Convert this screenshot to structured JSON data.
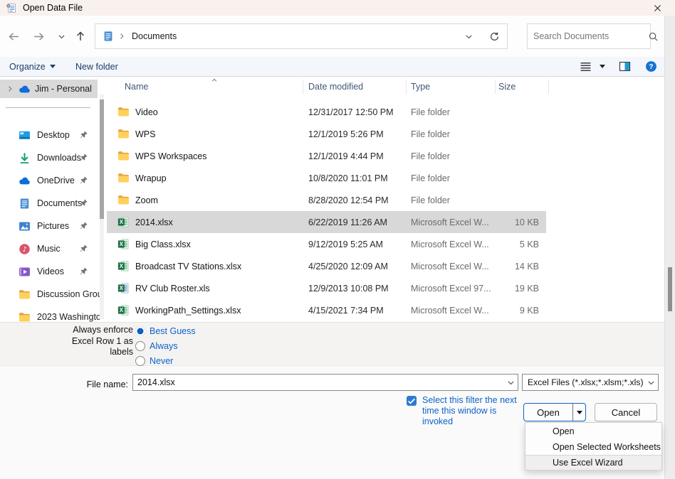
{
  "window": {
    "title": "Open Data File"
  },
  "nav": {
    "breadcrumb": "Documents",
    "search_placeholder": "Search Documents"
  },
  "toolbar": {
    "organize": "Organize",
    "new_folder": "New folder"
  },
  "sidebar": {
    "root_label": "Jim - Personal",
    "items": [
      {
        "label": "Desktop",
        "icon": "desktop",
        "pinned": true
      },
      {
        "label": "Downloads",
        "icon": "downloads",
        "pinned": true
      },
      {
        "label": "OneDrive",
        "icon": "cloud",
        "pinned": true
      },
      {
        "label": "Documents",
        "icon": "document",
        "pinned": true
      },
      {
        "label": "Pictures",
        "icon": "pictures",
        "pinned": true
      },
      {
        "label": "Music",
        "icon": "music",
        "pinned": true
      },
      {
        "label": "Videos",
        "icon": "videos",
        "pinned": true
      },
      {
        "label": "Discussion Grou",
        "icon": "folder",
        "pinned": false
      },
      {
        "label": "2023 Washingto",
        "icon": "folder",
        "pinned": false
      }
    ]
  },
  "file_list": {
    "columns": {
      "name": "Name",
      "date": "Date modified",
      "type": "Type",
      "size": "Size"
    },
    "rows": [
      {
        "name": "Video",
        "date": "12/31/2017 12:50 PM",
        "type": "File folder",
        "size": "",
        "icon": "folder",
        "selected": false
      },
      {
        "name": "WPS",
        "date": "12/1/2019 5:26 PM",
        "type": "File folder",
        "size": "",
        "icon": "folder",
        "selected": false
      },
      {
        "name": "WPS Workspaces",
        "date": "12/1/2019 4:44 PM",
        "type": "File folder",
        "size": "",
        "icon": "folder",
        "selected": false
      },
      {
        "name": "Wrapup",
        "date": "10/8/2020 11:01 PM",
        "type": "File folder",
        "size": "",
        "icon": "folder",
        "selected": false
      },
      {
        "name": "Zoom",
        "date": "8/28/2020 12:54 PM",
        "type": "File folder",
        "size": "",
        "icon": "folder",
        "selected": false
      },
      {
        "name": "2014.xlsx",
        "date": "6/22/2019 11:26 AM",
        "type": "Microsoft Excel W...",
        "size": "10 KB",
        "icon": "excel",
        "selected": true
      },
      {
        "name": "Big Class.xlsx",
        "date": "9/12/2019 5:25 AM",
        "type": "Microsoft Excel W...",
        "size": "5 KB",
        "icon": "excel",
        "selected": false
      },
      {
        "name": "Broadcast TV Stations.xlsx",
        "date": "4/25/2020 12:09 AM",
        "type": "Microsoft Excel W...",
        "size": "14 KB",
        "icon": "excel",
        "selected": false
      },
      {
        "name": "RV Club Roster.xls",
        "date": "12/9/2013 10:08 PM",
        "type": "Microsoft Excel 97...",
        "size": "19 KB",
        "icon": "excel-old",
        "selected": false
      },
      {
        "name": "WorkingPath_Settings.xlsx",
        "date": "4/15/2021 7:34 PM",
        "type": "Microsoft Excel W...",
        "size": "9 KB",
        "icon": "excel",
        "selected": false
      }
    ]
  },
  "options": {
    "label_lines": [
      "Always enforce",
      "Excel Row 1 as",
      "labels"
    ],
    "radios": [
      {
        "label": "Best Guess",
        "checked": true
      },
      {
        "label": "Always",
        "checked": false
      },
      {
        "label": "Never",
        "checked": false
      }
    ]
  },
  "file_name": {
    "label": "File name:",
    "value": "2014.xlsx"
  },
  "filter": {
    "value": "Excel Files  (*.xlsx;*.xlsm;*.xls)"
  },
  "filter_checkbox": {
    "checked": true,
    "lines": [
      "Select this filter the next",
      "time this window is",
      "invoked"
    ]
  },
  "buttons": {
    "open": "Open",
    "cancel": "Cancel"
  },
  "menu": {
    "items": [
      {
        "label": "Open",
        "highlighted": false
      },
      {
        "label": "Open Selected Worksheets",
        "highlighted": false
      },
      {
        "label": "Use Excel Wizard",
        "highlighted": true
      }
    ]
  },
  "accent_colors": {
    "blue": "#0d62c9",
    "selection_gray": "#d8d8d8",
    "titlebar": "#f9f1ee"
  }
}
